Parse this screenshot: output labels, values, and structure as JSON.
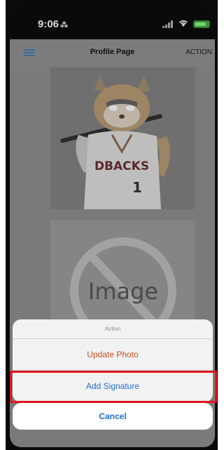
{
  "status_bar": {
    "time": "9:06",
    "time_icon": "silent-mode-icon",
    "signal_icon": "cellular-signal-icon",
    "wifi_icon": "wifi-icon",
    "battery_icon": "battery-charging-icon",
    "battery_color": "#3a8f3a"
  },
  "nav": {
    "menu_icon": "hamburger-menu-icon",
    "title": "Profile Page",
    "action_label": "ACTION"
  },
  "profile_photo": {
    "jersey_text": "DBACKS",
    "jersey_number": "1"
  },
  "signature_placeholder": {
    "label": "Image"
  },
  "action_sheet": {
    "title": "Action",
    "update_photo_label": "Update Photo",
    "add_signature_label": "Add Signature",
    "cancel_label": "Cancel"
  },
  "colors": {
    "update_photo_text": "#c0521c",
    "button_text_blue": "#1f6ed1",
    "highlight_border": "#e0161e"
  }
}
